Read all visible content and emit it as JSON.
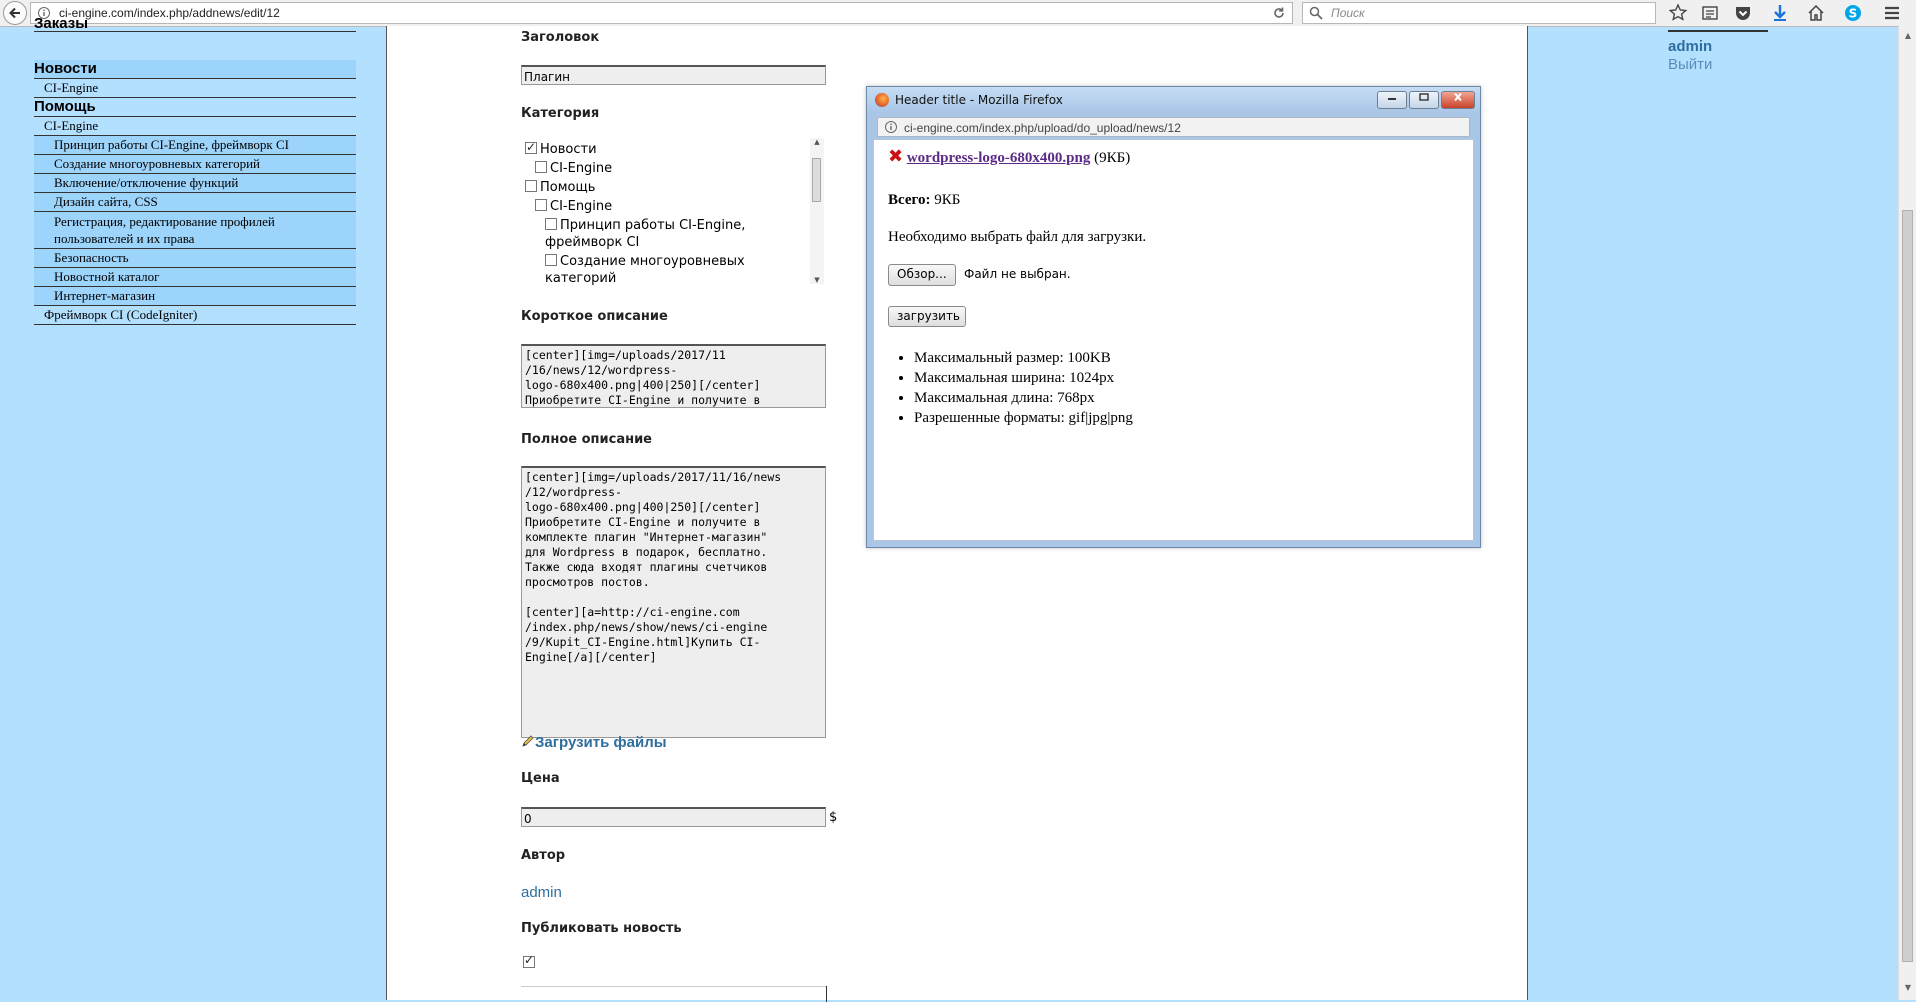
{
  "browser": {
    "url": "ci-engine.com/index.php/addnews/edit/12",
    "search_placeholder": "Поиск"
  },
  "nav": {
    "cut_top_label": "Заказы",
    "items": [
      {
        "label": "Новости",
        "level": "h1"
      },
      {
        "label": "CI-Engine",
        "level": "l1"
      },
      {
        "label": "Помощь",
        "level": "h1"
      },
      {
        "label": "CI-Engine",
        "level": "l1"
      },
      {
        "label": "Принцип работы CI-Engine, фреймворк CI",
        "level": "l2"
      },
      {
        "label": "Создание многоуровневых категорий",
        "level": "l2"
      },
      {
        "label": "Включение/отключение функций",
        "level": "l2"
      },
      {
        "label": "Дизайн сайта, CSS",
        "level": "l2"
      },
      {
        "label": "Регистрация, редактирование профилей пользователей и их права",
        "level": "l2"
      },
      {
        "label": "Безопасность",
        "level": "l2"
      },
      {
        "label": "Новостной каталог",
        "level": "l2"
      },
      {
        "label": "Интернет-магазин",
        "level": "l2"
      },
      {
        "label": "Фреймворк CI (CodeIgniter)",
        "level": "l1"
      }
    ]
  },
  "user": {
    "name": "admin",
    "logout": "Выйти"
  },
  "form": {
    "title_label": "Заголовок",
    "title_value": "Плагин",
    "category_label": "Категория",
    "categories": [
      {
        "label": "Новости",
        "checked": true
      },
      {
        "label": "CI-Engine",
        "checked": false
      },
      {
        "label": "Помощь",
        "checked": false
      },
      {
        "label": "CI-Engine",
        "checked": false
      },
      {
        "label": "Принцип работы CI-Engine, фреймворк CI",
        "checked": false
      },
      {
        "label": "Создание многоуровневых категорий",
        "checked": false
      }
    ],
    "short_desc_label": "Короткое описание",
    "short_desc_lines": [
      "[center][img=/uploads/2017/11",
      "/16/news/12/wordpress-",
      "logo-680x400.png|400|250][/center]",
      "Приобретите CI-Engine и получите в"
    ],
    "full_desc_label": "Полное описание",
    "full_desc_lines": [
      "[center][img=/uploads/2017/11/16/news",
      "/12/wordpress-",
      "logo-680x400.png|400|250][/center]",
      "Приобретите CI-Engine и получите в",
      "комплекте плагин \"Интернет-магазин\"",
      "для Wordpress в подарок, бесплатно.",
      "Также сюда входят плагины счетчиков",
      "просмотров постов.",
      "",
      "[center][a=http://ci-engine.com",
      "/index.php/news/show/news/ci-engine",
      "/9/Kupit_CI-Engine.html]Купить CI-",
      "Engine[/a][/center]"
    ],
    "upload_link": "Загрузить файлы",
    "price_label": "Цена",
    "price_value": "0",
    "currency": "$",
    "author_label": "Автор",
    "author_value": "admin",
    "publish_label": "Публиковать новость",
    "publish_checked": true
  },
  "popup": {
    "title": "Header title - Mozilla Firefox",
    "url": "ci-engine.com/index.php/upload/do_upload/news/12",
    "file_name": "wordpress-logo-680x400.png",
    "file_size": "(9КБ)",
    "total_label": "Всего:",
    "total_value": "9КБ",
    "message": "Необходимо выбрать файл для загрузки.",
    "browse_button": "Обзор...",
    "no_file": "Файл не выбран.",
    "upload_button": "загрузить",
    "limits": [
      "Максимальный размер: 100KB",
      "Максимальная ширина: 1024px",
      "Максимальная длина: 768px",
      "Разрешенные форматы: gif|jpg|png"
    ]
  }
}
